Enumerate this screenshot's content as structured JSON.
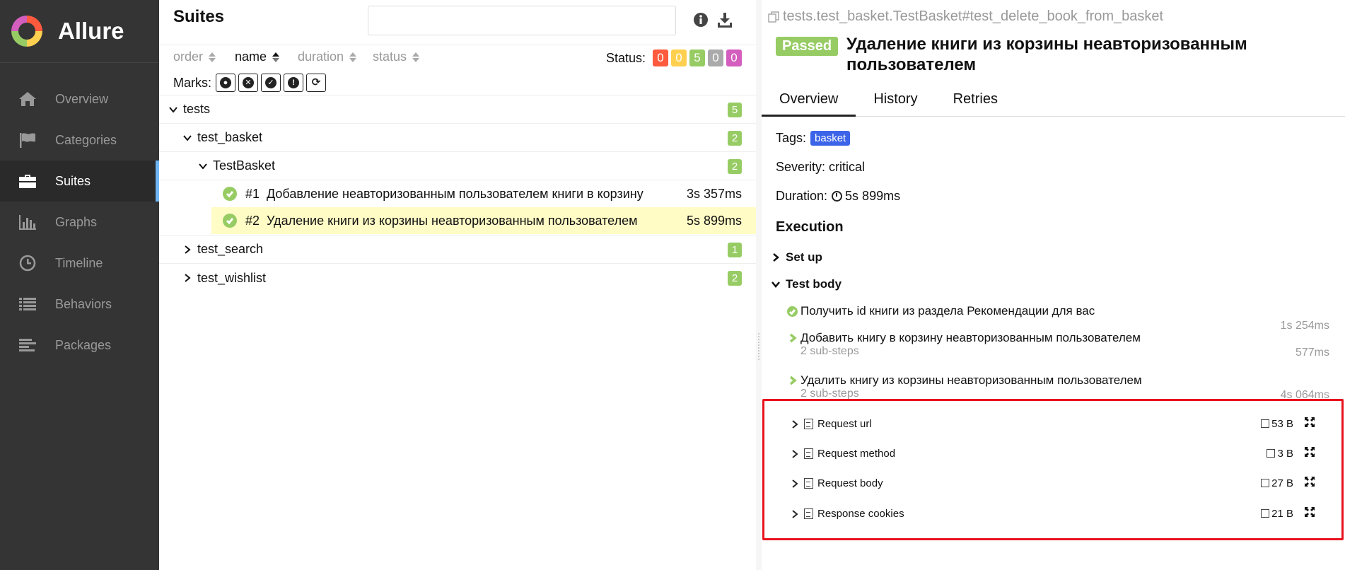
{
  "brand": {
    "name": "Allure"
  },
  "sidebar": {
    "items": [
      {
        "label": "Overview",
        "icon": "home-icon"
      },
      {
        "label": "Categories",
        "icon": "flag-icon"
      },
      {
        "label": "Suites",
        "icon": "briefcase-icon",
        "active": true
      },
      {
        "label": "Graphs",
        "icon": "bar-chart-icon"
      },
      {
        "label": "Timeline",
        "icon": "clock-icon"
      },
      {
        "label": "Behaviors",
        "icon": "list-icon"
      },
      {
        "label": "Packages",
        "icon": "align-left-icon"
      }
    ]
  },
  "suites": {
    "title": "Suites",
    "search_value": "",
    "sorters": [
      "order",
      "name",
      "duration",
      "status"
    ],
    "status_label": "Status:",
    "status_counts": [
      "0",
      "0",
      "5",
      "0",
      "0"
    ],
    "status_colors": [
      "#fd5a3e",
      "#ffd050",
      "#97cc64",
      "#aaaaaa",
      "#d35ebe"
    ],
    "marks_label": "Marks:",
    "tree": {
      "root": {
        "name": "tests",
        "count": "5"
      },
      "basket": {
        "name": "test_basket",
        "count": "2"
      },
      "class": {
        "name": "TestBasket",
        "count": "2"
      },
      "tests": [
        {
          "num": "#1",
          "name": "Добавление неавторизованным пользователем книги в корзину",
          "duration": "3s 357ms"
        },
        {
          "num": "#2",
          "name": "Удаление книги из корзины неавторизованным пользователем",
          "duration": "5s 899ms"
        }
      ],
      "search": {
        "name": "test_search",
        "count": "1"
      },
      "wishlist": {
        "name": "test_wishlist",
        "count": "2"
      }
    }
  },
  "detail": {
    "path": "tests.test_basket.TestBasket#test_delete_book_from_basket",
    "status": "Passed",
    "title": "Удаление книги из корзины неавторизованным пользователем",
    "tabs": [
      "Overview",
      "History",
      "Retries"
    ],
    "tags_label": "Tags:",
    "tag": "basket",
    "severity": "Severity: critical",
    "duration_label": "Duration:",
    "duration": "5s 899ms",
    "execution": "Execution",
    "setup": "Set up",
    "test_body": "Test body",
    "steps": [
      {
        "name": "Получить id книги из раздела Рекомендации для вас",
        "duration": "1s 254ms",
        "sub": ""
      },
      {
        "name": "Добавить книгу в корзину неавторизованным пользователем",
        "duration": "577ms",
        "sub": "2 sub-steps"
      },
      {
        "name": "Удалить книгу из корзины неавторизованным пользователем",
        "duration": "4s 064ms",
        "sub": "2 sub-steps"
      }
    ],
    "attachments": [
      {
        "name": "Request url",
        "size": "53 B"
      },
      {
        "name": "Request method",
        "size": "3 B"
      },
      {
        "name": "Request body",
        "size": "27 B"
      },
      {
        "name": "Response cookies",
        "size": "21 B"
      }
    ]
  }
}
